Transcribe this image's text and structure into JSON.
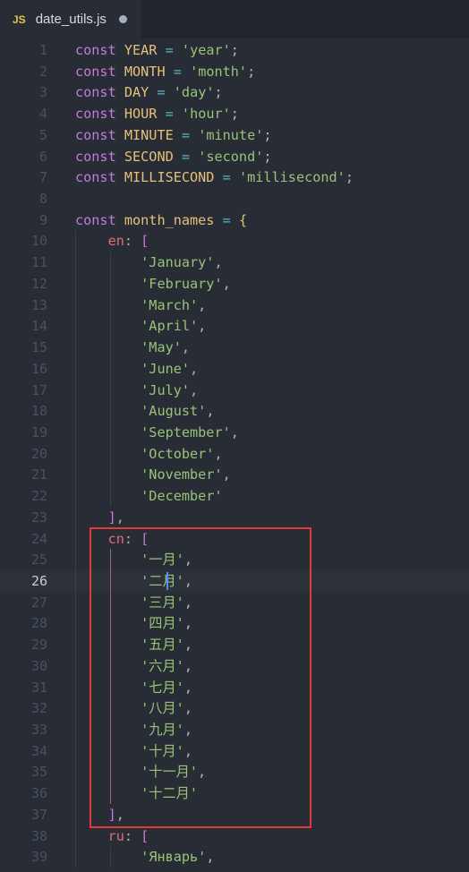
{
  "tab": {
    "icon": "JS",
    "title": "date_utils.js",
    "modified_indicator": "unsaved-dot"
  },
  "editor": {
    "current_line": 26,
    "lines": [
      {
        "n": "1",
        "tokens": [
          [
            "kw",
            "const "
          ],
          [
            "var",
            "YEAR"
          ],
          [
            "pn",
            " "
          ],
          [
            "op",
            "="
          ],
          [
            "pn",
            " "
          ],
          [
            "str",
            "'year'"
          ],
          [
            "pn",
            ";"
          ]
        ]
      },
      {
        "n": "2",
        "tokens": [
          [
            "kw",
            "const "
          ],
          [
            "var",
            "MONTH"
          ],
          [
            "pn",
            " "
          ],
          [
            "op",
            "="
          ],
          [
            "pn",
            " "
          ],
          [
            "str",
            "'month'"
          ],
          [
            "pn",
            ";"
          ]
        ]
      },
      {
        "n": "3",
        "tokens": [
          [
            "kw",
            "const "
          ],
          [
            "var",
            "DAY"
          ],
          [
            "pn",
            " "
          ],
          [
            "op",
            "="
          ],
          [
            "pn",
            " "
          ],
          [
            "str",
            "'day'"
          ],
          [
            "pn",
            ";"
          ]
        ]
      },
      {
        "n": "4",
        "tokens": [
          [
            "kw",
            "const "
          ],
          [
            "var",
            "HOUR"
          ],
          [
            "pn",
            " "
          ],
          [
            "op",
            "="
          ],
          [
            "pn",
            " "
          ],
          [
            "str",
            "'hour'"
          ],
          [
            "pn",
            ";"
          ]
        ]
      },
      {
        "n": "5",
        "tokens": [
          [
            "kw",
            "const "
          ],
          [
            "var",
            "MINUTE"
          ],
          [
            "pn",
            " "
          ],
          [
            "op",
            "="
          ],
          [
            "pn",
            " "
          ],
          [
            "str",
            "'minute'"
          ],
          [
            "pn",
            ";"
          ]
        ]
      },
      {
        "n": "6",
        "tokens": [
          [
            "kw",
            "const "
          ],
          [
            "var",
            "SECOND"
          ],
          [
            "pn",
            " "
          ],
          [
            "op",
            "="
          ],
          [
            "pn",
            " "
          ],
          [
            "str",
            "'second'"
          ],
          [
            "pn",
            ";"
          ]
        ]
      },
      {
        "n": "7",
        "tokens": [
          [
            "kw",
            "const "
          ],
          [
            "var",
            "MILLISECOND"
          ],
          [
            "pn",
            " "
          ],
          [
            "op",
            "="
          ],
          [
            "pn",
            " "
          ],
          [
            "str",
            "'millisecond'"
          ],
          [
            "pn",
            ";"
          ]
        ]
      },
      {
        "n": "8",
        "tokens": []
      },
      {
        "n": "9",
        "tokens": [
          [
            "kw",
            "const "
          ],
          [
            "var",
            "month_names"
          ],
          [
            "pn",
            " "
          ],
          [
            "op",
            "="
          ],
          [
            "pn",
            " "
          ],
          [
            "br1",
            "{"
          ]
        ]
      },
      {
        "n": "10",
        "tokens": [
          [
            "pn",
            "    "
          ],
          [
            "prop",
            "en"
          ],
          [
            "pn",
            ": "
          ],
          [
            "br2",
            "["
          ]
        ]
      },
      {
        "n": "11",
        "tokens": [
          [
            "pn",
            "        "
          ],
          [
            "str",
            "'January'"
          ],
          [
            "pn",
            ","
          ]
        ]
      },
      {
        "n": "12",
        "tokens": [
          [
            "pn",
            "        "
          ],
          [
            "str",
            "'February'"
          ],
          [
            "pn",
            ","
          ]
        ]
      },
      {
        "n": "13",
        "tokens": [
          [
            "pn",
            "        "
          ],
          [
            "str",
            "'March'"
          ],
          [
            "pn",
            ","
          ]
        ]
      },
      {
        "n": "14",
        "tokens": [
          [
            "pn",
            "        "
          ],
          [
            "str",
            "'April'"
          ],
          [
            "pn",
            ","
          ]
        ]
      },
      {
        "n": "15",
        "tokens": [
          [
            "pn",
            "        "
          ],
          [
            "str",
            "'May'"
          ],
          [
            "pn",
            ","
          ]
        ]
      },
      {
        "n": "16",
        "tokens": [
          [
            "pn",
            "        "
          ],
          [
            "str",
            "'June'"
          ],
          [
            "pn",
            ","
          ]
        ]
      },
      {
        "n": "17",
        "tokens": [
          [
            "pn",
            "        "
          ],
          [
            "str",
            "'July'"
          ],
          [
            "pn",
            ","
          ]
        ]
      },
      {
        "n": "18",
        "tokens": [
          [
            "pn",
            "        "
          ],
          [
            "str",
            "'August'"
          ],
          [
            "pn",
            ","
          ]
        ]
      },
      {
        "n": "19",
        "tokens": [
          [
            "pn",
            "        "
          ],
          [
            "str",
            "'September'"
          ],
          [
            "pn",
            ","
          ]
        ]
      },
      {
        "n": "20",
        "tokens": [
          [
            "pn",
            "        "
          ],
          [
            "str",
            "'October'"
          ],
          [
            "pn",
            ","
          ]
        ]
      },
      {
        "n": "21",
        "tokens": [
          [
            "pn",
            "        "
          ],
          [
            "str",
            "'November'"
          ],
          [
            "pn",
            ","
          ]
        ]
      },
      {
        "n": "22",
        "tokens": [
          [
            "pn",
            "        "
          ],
          [
            "str",
            "'December'"
          ]
        ]
      },
      {
        "n": "23",
        "tokens": [
          [
            "pn",
            "    "
          ],
          [
            "br2",
            "]"
          ],
          [
            "pn",
            ","
          ]
        ]
      },
      {
        "n": "24",
        "tokens": [
          [
            "pn",
            "    "
          ],
          [
            "prop",
            "cn"
          ],
          [
            "pn",
            ": "
          ],
          [
            "br2",
            "["
          ]
        ]
      },
      {
        "n": "25",
        "tokens": [
          [
            "pn",
            "        "
          ],
          [
            "str",
            "'一月'"
          ],
          [
            "pn",
            ","
          ]
        ]
      },
      {
        "n": "26",
        "tokens": [
          [
            "pn",
            "        "
          ],
          [
            "str",
            "'二月'"
          ],
          [
            "pn",
            ","
          ]
        ]
      },
      {
        "n": "27",
        "tokens": [
          [
            "pn",
            "        "
          ],
          [
            "str",
            "'三月'"
          ],
          [
            "pn",
            ","
          ]
        ]
      },
      {
        "n": "28",
        "tokens": [
          [
            "pn",
            "        "
          ],
          [
            "str",
            "'四月'"
          ],
          [
            "pn",
            ","
          ]
        ]
      },
      {
        "n": "29",
        "tokens": [
          [
            "pn",
            "        "
          ],
          [
            "str",
            "'五月'"
          ],
          [
            "pn",
            ","
          ]
        ]
      },
      {
        "n": "30",
        "tokens": [
          [
            "pn",
            "        "
          ],
          [
            "str",
            "'六月'"
          ],
          [
            "pn",
            ","
          ]
        ]
      },
      {
        "n": "31",
        "tokens": [
          [
            "pn",
            "        "
          ],
          [
            "str",
            "'七月'"
          ],
          [
            "pn",
            ","
          ]
        ]
      },
      {
        "n": "32",
        "tokens": [
          [
            "pn",
            "        "
          ],
          [
            "str",
            "'八月'"
          ],
          [
            "pn",
            ","
          ]
        ]
      },
      {
        "n": "33",
        "tokens": [
          [
            "pn",
            "        "
          ],
          [
            "str",
            "'九月'"
          ],
          [
            "pn",
            ","
          ]
        ]
      },
      {
        "n": "34",
        "tokens": [
          [
            "pn",
            "        "
          ],
          [
            "str",
            "'十月'"
          ],
          [
            "pn",
            ","
          ]
        ]
      },
      {
        "n": "35",
        "tokens": [
          [
            "pn",
            "        "
          ],
          [
            "str",
            "'十一月'"
          ],
          [
            "pn",
            ","
          ]
        ]
      },
      {
        "n": "36",
        "tokens": [
          [
            "pn",
            "        "
          ],
          [
            "str",
            "'十二月'"
          ]
        ]
      },
      {
        "n": "37",
        "tokens": [
          [
            "pn",
            "    "
          ],
          [
            "br2",
            "]"
          ],
          [
            "pn",
            ","
          ]
        ]
      },
      {
        "n": "38",
        "tokens": [
          [
            "pn",
            "    "
          ],
          [
            "prop",
            "ru"
          ],
          [
            "pn",
            ": "
          ],
          [
            "br2",
            "["
          ]
        ]
      },
      {
        "n": "39",
        "tokens": [
          [
            "pn",
            "        "
          ],
          [
            "str",
            "'Январь'"
          ],
          [
            "pn",
            ","
          ]
        ]
      }
    ]
  },
  "colors": {
    "background": "#282c34",
    "keyword": "#c678dd",
    "constant": "#e5c07b",
    "string": "#98c379",
    "property": "#e06c75",
    "operator": "#56b6c2",
    "annotation_box": "#e03a3a"
  }
}
